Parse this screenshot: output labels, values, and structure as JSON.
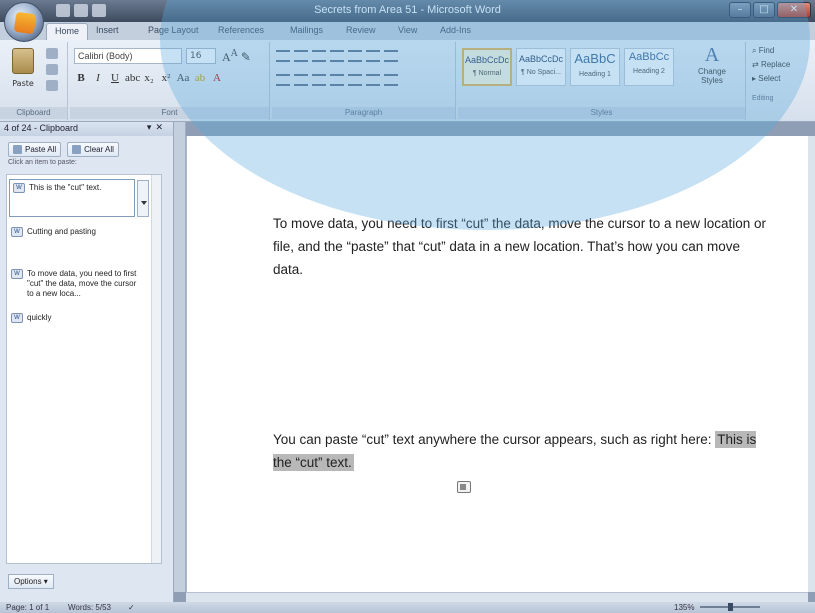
{
  "window": {
    "title": "Secrets from Area 51 - Microsoft Word",
    "controls": [
      "–",
      "□",
      "✕"
    ]
  },
  "tabs": [
    "Home",
    "Insert",
    "Page Layout",
    "References",
    "Mailings",
    "Review",
    "View",
    "Add-Ins"
  ],
  "ribbon": {
    "clipboard": {
      "paste_label": "Paste",
      "group_label": "Clipboard"
    },
    "font": {
      "name": "Calibri (Body)",
      "size": "16",
      "group_label": "Font"
    },
    "paragraph": {
      "group_label": "Paragraph"
    },
    "styles": {
      "group_label": "Styles",
      "items": [
        {
          "sample": "AaBbCcDc",
          "name": "¶ Normal"
        },
        {
          "sample": "AaBbCcDc",
          "name": "¶ No Spaci..."
        },
        {
          "sample": "AaBbC",
          "name": "Heading 1"
        },
        {
          "sample": "AaBbCc",
          "name": "Heading 2"
        }
      ],
      "change_styles": "Change Styles"
    },
    "editing": {
      "group_label": "Editing",
      "find": "Find",
      "replace": "Replace",
      "select": "Select"
    }
  },
  "clipboard_pane": {
    "header": "4 of 24 - Clipboard",
    "paste_all": "Paste All",
    "clear_all": "Clear All",
    "hint": "Click an item to paste:",
    "items": [
      "This is the \"cut\" text.",
      "Cutting and pasting",
      "To move data, you need to first \"cut\" the data, move the cursor to a new loca...",
      "quickly"
    ],
    "options": "Options"
  },
  "document": {
    "paragraph1": "To move data, you need to first “cut” the data, move the cursor to a new location or file, and the “paste” that “cut” data in a new location. That’s how you can move data.",
    "paragraph2_prefix": "You can paste “cut” text anywhere the cursor appears, such as right here: ",
    "paragraph2_highlight": "This is the “cut” text."
  },
  "status": {
    "page": "Page: 1 of 1",
    "words": "Words: 5/53",
    "zoom": "135%"
  }
}
